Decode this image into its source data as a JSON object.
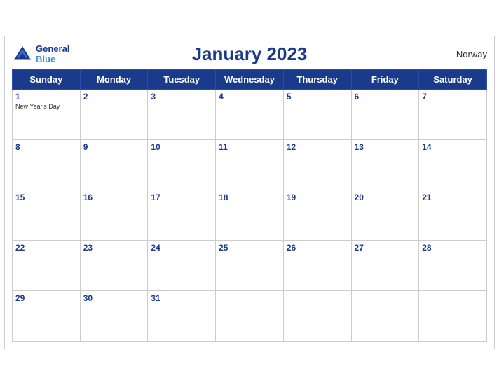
{
  "header": {
    "title": "January 2023",
    "country": "Norway",
    "logo_general": "General",
    "logo_blue": "Blue"
  },
  "days_of_week": [
    "Sunday",
    "Monday",
    "Tuesday",
    "Wednesday",
    "Thursday",
    "Friday",
    "Saturday"
  ],
  "weeks": [
    [
      {
        "day": "1",
        "holiday": "New Year's Day"
      },
      {
        "day": "2",
        "holiday": ""
      },
      {
        "day": "3",
        "holiday": ""
      },
      {
        "day": "4",
        "holiday": ""
      },
      {
        "day": "5",
        "holiday": ""
      },
      {
        "day": "6",
        "holiday": ""
      },
      {
        "day": "7",
        "holiday": ""
      }
    ],
    [
      {
        "day": "8",
        "holiday": ""
      },
      {
        "day": "9",
        "holiday": ""
      },
      {
        "day": "10",
        "holiday": ""
      },
      {
        "day": "11",
        "holiday": ""
      },
      {
        "day": "12",
        "holiday": ""
      },
      {
        "day": "13",
        "holiday": ""
      },
      {
        "day": "14",
        "holiday": ""
      }
    ],
    [
      {
        "day": "15",
        "holiday": ""
      },
      {
        "day": "16",
        "holiday": ""
      },
      {
        "day": "17",
        "holiday": ""
      },
      {
        "day": "18",
        "holiday": ""
      },
      {
        "day": "19",
        "holiday": ""
      },
      {
        "day": "20",
        "holiday": ""
      },
      {
        "day": "21",
        "holiday": ""
      }
    ],
    [
      {
        "day": "22",
        "holiday": ""
      },
      {
        "day": "23",
        "holiday": ""
      },
      {
        "day": "24",
        "holiday": ""
      },
      {
        "day": "25",
        "holiday": ""
      },
      {
        "day": "26",
        "holiday": ""
      },
      {
        "day": "27",
        "holiday": ""
      },
      {
        "day": "28",
        "holiday": ""
      }
    ],
    [
      {
        "day": "29",
        "holiday": ""
      },
      {
        "day": "30",
        "holiday": ""
      },
      {
        "day": "31",
        "holiday": ""
      },
      {
        "day": "",
        "holiday": ""
      },
      {
        "day": "",
        "holiday": ""
      },
      {
        "day": "",
        "holiday": ""
      },
      {
        "day": "",
        "holiday": ""
      }
    ]
  ],
  "colors": {
    "header_bg": "#1a3a8c",
    "header_text": "#ffffff",
    "title_color": "#1a3a8c",
    "day_number_color": "#1a3a8c"
  }
}
